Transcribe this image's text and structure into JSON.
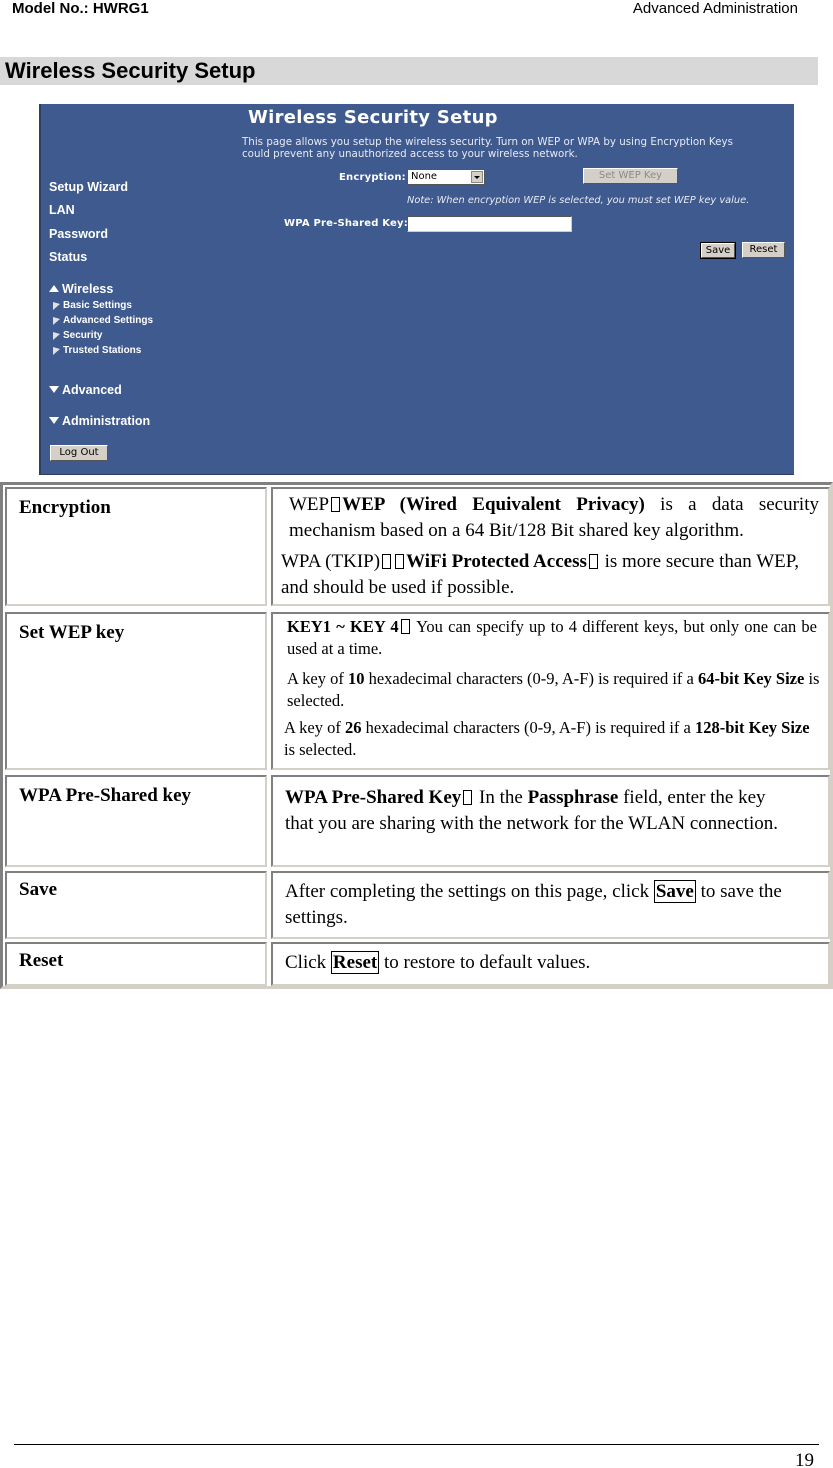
{
  "header": {
    "model": "Model No.: HWRG1",
    "section": "Advanced Administration"
  },
  "section_title": "Wireless Security Setup",
  "router_ui": {
    "title": "Wireless Security Setup",
    "description": "This page allows you setup the wireless security. Turn on WEP or WPA by using Encryption Keys could prevent any unauthorized access to your wireless network.",
    "nav": {
      "main": [
        "Setup Wizard",
        "LAN",
        "Password",
        "Status"
      ],
      "wireless": {
        "label": "Wireless",
        "items": [
          "Basic Settings",
          "Advanced Settings",
          "Security",
          "Trusted Stations"
        ]
      },
      "advanced": "Advanced",
      "administration": "Administration",
      "logout": "Log Out"
    },
    "encryption_label": "Encryption:",
    "encryption_value": "None",
    "set_wep_key": "Set WEP Key",
    "note": "Note: When encryption WEP is selected, you must set WEP key value.",
    "wpa_psk_label": "WPA Pre-Shared Key:",
    "wpa_psk_value": "",
    "save": "Save",
    "reset": "Reset"
  },
  "table": {
    "rows": [
      {
        "label": "Encryption",
        "p1_a": "WEP",
        "p1_b": "WEP (Wired Equivalent Privacy)",
        "p1_c": " is a data security mechanism based on a 64 Bit/128 Bit shared key algorithm.",
        "p2_a": "WPA (TKIP)",
        "p2_b": "WiFi Protected Access",
        "p2_c": " is more secure than WEP, and should be used if possible."
      },
      {
        "label": "Set WEP key",
        "p1_a": "KEY1 ~ KEY 4",
        "p1_c": " You can specify up to 4 different keys, but only one can be used at a time.",
        "p2_a": "A key of ",
        "p2_b": "10",
        "p2_c": " hexadecimal characters (0-9, A-F) is required if a ",
        "p2_d": "64-bit Key Size",
        "p2_e": " is selected.",
        "p3_a": "A key of ",
        "p3_b": "26",
        "p3_c": " hexadecimal characters (0-9, A-F) is required if a ",
        "p3_d": "128-bit Key Size",
        "p3_e": " is selected."
      },
      {
        "label": "WPA Pre-Shared key",
        "p1_a": "WPA Pre-Shared Key",
        "p1_b": " In the ",
        "p1_c": "Passphrase",
        "p1_d": " field, enter the key that you are sharing with the network for the WLAN connection."
      },
      {
        "label": "Save",
        "p1_a": "After completing the settings on this page, click ",
        "p1_b": "Save",
        "p1_c": " to save the settings."
      },
      {
        "label": "Reset",
        "p1_a": "Click ",
        "p1_b": "Reset",
        "p1_c": " to restore to default values."
      }
    ]
  },
  "footer": {
    "page_number": "19"
  }
}
